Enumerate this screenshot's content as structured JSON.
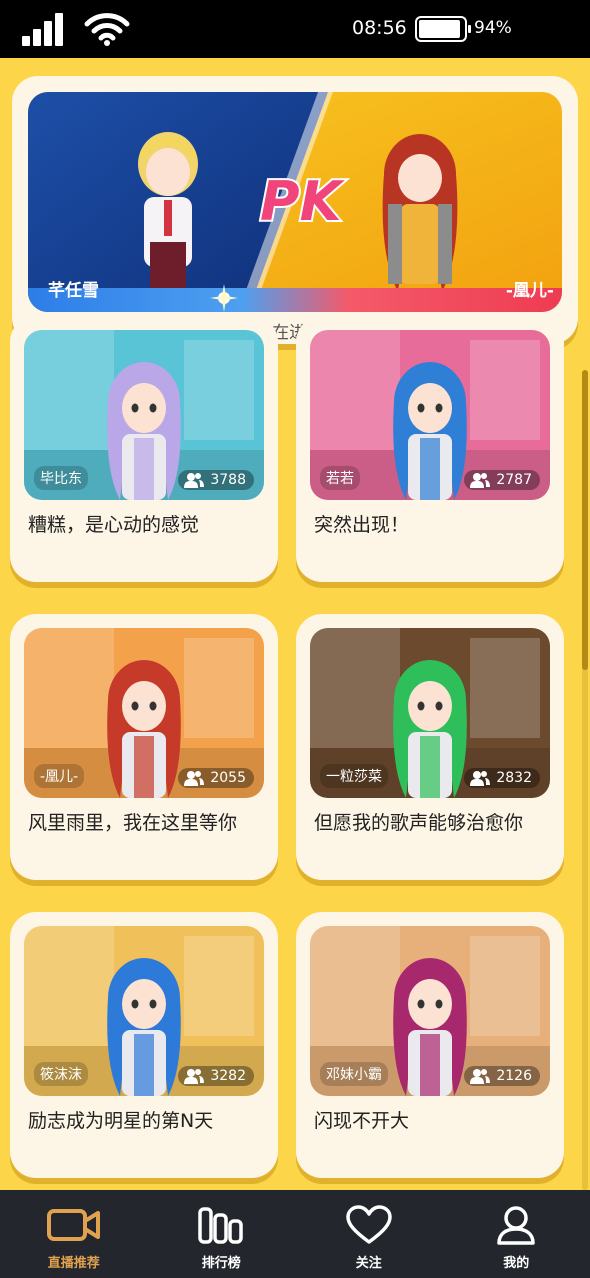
{
  "status_bar": {
    "time": "08:56",
    "battery_pct": "94%",
    "battery_level": 0.94
  },
  "pk_banner": {
    "left_name": "芊任雪",
    "right_name": "-凰儿-",
    "pk_text": "PK",
    "status": "PK正在进行中..."
  },
  "streams": [
    {
      "streamer": "毕比东",
      "viewers": "3788",
      "title": "糟糕，是心动的感觉",
      "hair": "#b9a7e8",
      "bg": "#59c4d6"
    },
    {
      "streamer": "若若",
      "viewers": "2787",
      "title": "突然出现！",
      "hair": "#2f7fd6",
      "bg": "#e86c9a"
    },
    {
      "streamer": "-凰儿-",
      "viewers": "2055",
      "title": "风里雨里，我在这里等你",
      "hair": "#c63a2a",
      "bg": "#f3a24b"
    },
    {
      "streamer": "一粒莎菜",
      "viewers": "2832",
      "title": "但愿我的歌声能够治愈你",
      "hair": "#2fbf5a",
      "bg": "#6b4a2e"
    },
    {
      "streamer": "筱沫沫",
      "viewers": "3282",
      "title": "励志成为明星的第N天",
      "hair": "#2e7ad9",
      "bg": "#f0c15a"
    },
    {
      "streamer": "邓妹小霸",
      "viewers": "2126",
      "title": "闪现不开大",
      "hair": "#a8286e",
      "bg": "#e7b07a"
    }
  ],
  "nav": [
    {
      "label": "直播推荐",
      "icon": "video-camera-icon",
      "active": true
    },
    {
      "label": "排行榜",
      "icon": "ranking-bars-icon",
      "active": false
    },
    {
      "label": "关注",
      "icon": "heart-icon",
      "active": false
    },
    {
      "label": "我的",
      "icon": "user-icon",
      "active": false
    }
  ],
  "colors": {
    "background": "#fdd548",
    "card": "#fdf6e6",
    "nav_bg": "#23262c",
    "nav_active": "#e0a24f"
  }
}
